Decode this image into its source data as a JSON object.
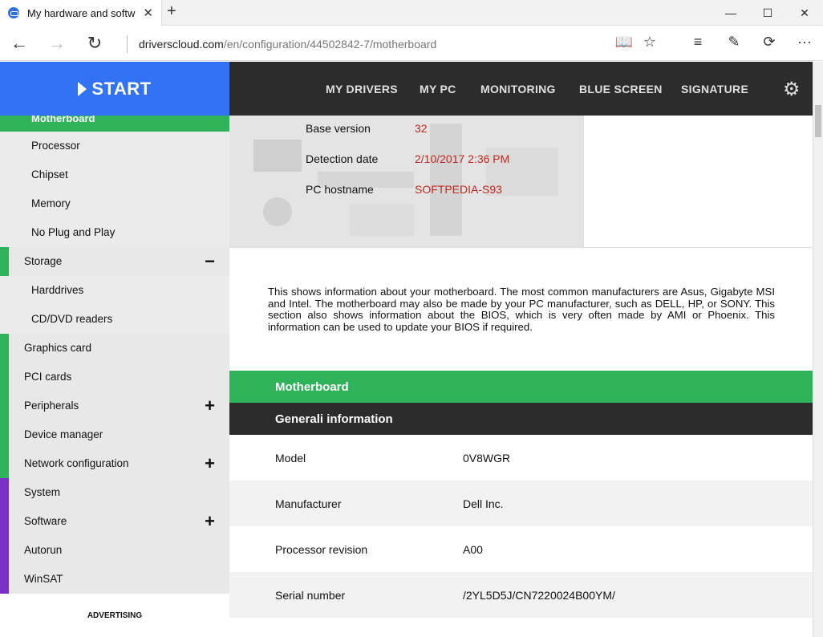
{
  "browser": {
    "tab_title": "My hardware and softw",
    "tab_close": "✕",
    "new_tab": "+",
    "url_host": "driverscloud.com",
    "url_path": "/en/configuration/44502842-7/motherboard",
    "controls": {
      "minimize": "—",
      "maximize": "☐",
      "close": "✕"
    },
    "nav": {
      "back": "←",
      "forward": "→",
      "refresh": "↻"
    },
    "tools": {
      "reading": "📖",
      "favorite": "☆",
      "hub": "≡",
      "note": "✎",
      "share": "⟳",
      "more": "···"
    }
  },
  "header": {
    "start_label": "START",
    "nav": [
      "MY DRIVERS",
      "MY PC",
      "MONITORING",
      "BLUE SCREEN",
      "SIGNATURE"
    ],
    "settings_icon": "gear-icon"
  },
  "sidebar": {
    "active": "Motherboard",
    "items": [
      {
        "label": "Processor",
        "type": "sub"
      },
      {
        "label": "Chipset",
        "type": "sub"
      },
      {
        "label": "Memory",
        "type": "sub"
      },
      {
        "label": "No Plug and Play",
        "type": "sub"
      },
      {
        "label": "Storage",
        "type": "top",
        "toggle": "−",
        "color": "#2fb35a"
      },
      {
        "label": "Harddrives",
        "type": "sub"
      },
      {
        "label": "CD/DVD readers",
        "type": "sub"
      },
      {
        "label": "Graphics card",
        "type": "top",
        "color": "#2fb35a"
      },
      {
        "label": "PCI cards",
        "type": "top",
        "color": "#2fb35a"
      },
      {
        "label": "Peripherals",
        "type": "top",
        "toggle": "+",
        "color": "#2fb35a"
      },
      {
        "label": "Device manager",
        "type": "top",
        "color": "#2fb35a"
      },
      {
        "label": "Network configuration",
        "type": "top",
        "toggle": "+",
        "color": "#2fb35a"
      },
      {
        "label": "System",
        "type": "top",
        "color": "#7b2fc9"
      },
      {
        "label": "Software",
        "type": "top",
        "toggle": "+",
        "color": "#7b2fc9"
      },
      {
        "label": "Autorun",
        "type": "top",
        "color": "#7b2fc9"
      },
      {
        "label": "WinSAT",
        "type": "top",
        "color": "#7b2fc9"
      }
    ],
    "advertising": "ADVERTISING"
  },
  "hero": {
    "rows": [
      {
        "key": "Base version",
        "value": "32"
      },
      {
        "key": "Detection date",
        "value": "2/10/2017 2:36 PM"
      },
      {
        "key": "PC hostname",
        "value": "SOFTPEDIA-S93"
      }
    ]
  },
  "description": "This shows information about your motherboard. The most common manufacturers are Asus, Gigabyte MSI and Intel. The motherboard may also be made by your PC manufacturer, such as DELL, HP, or SONY. This section also shows information about the BIOS, which is very often made by AMI or Phoenix. This information can be used to update your BIOS if required.",
  "section": {
    "title": "Motherboard",
    "subtitle": "Generali information",
    "rows": [
      {
        "key": "Model",
        "value": "0V8WGR"
      },
      {
        "key": "Manufacturer",
        "value": "Dell Inc."
      },
      {
        "key": "Processor revision",
        "value": "A00"
      },
      {
        "key": "Serial number",
        "value": "/2YL5D5J/CN7220024B00YM/"
      }
    ]
  },
  "colors": {
    "accent_blue": "#3273f6",
    "green": "#2fb35a",
    "purple": "#7b2fc9",
    "dark": "#2c2c2c",
    "value_red": "#c0281d"
  }
}
